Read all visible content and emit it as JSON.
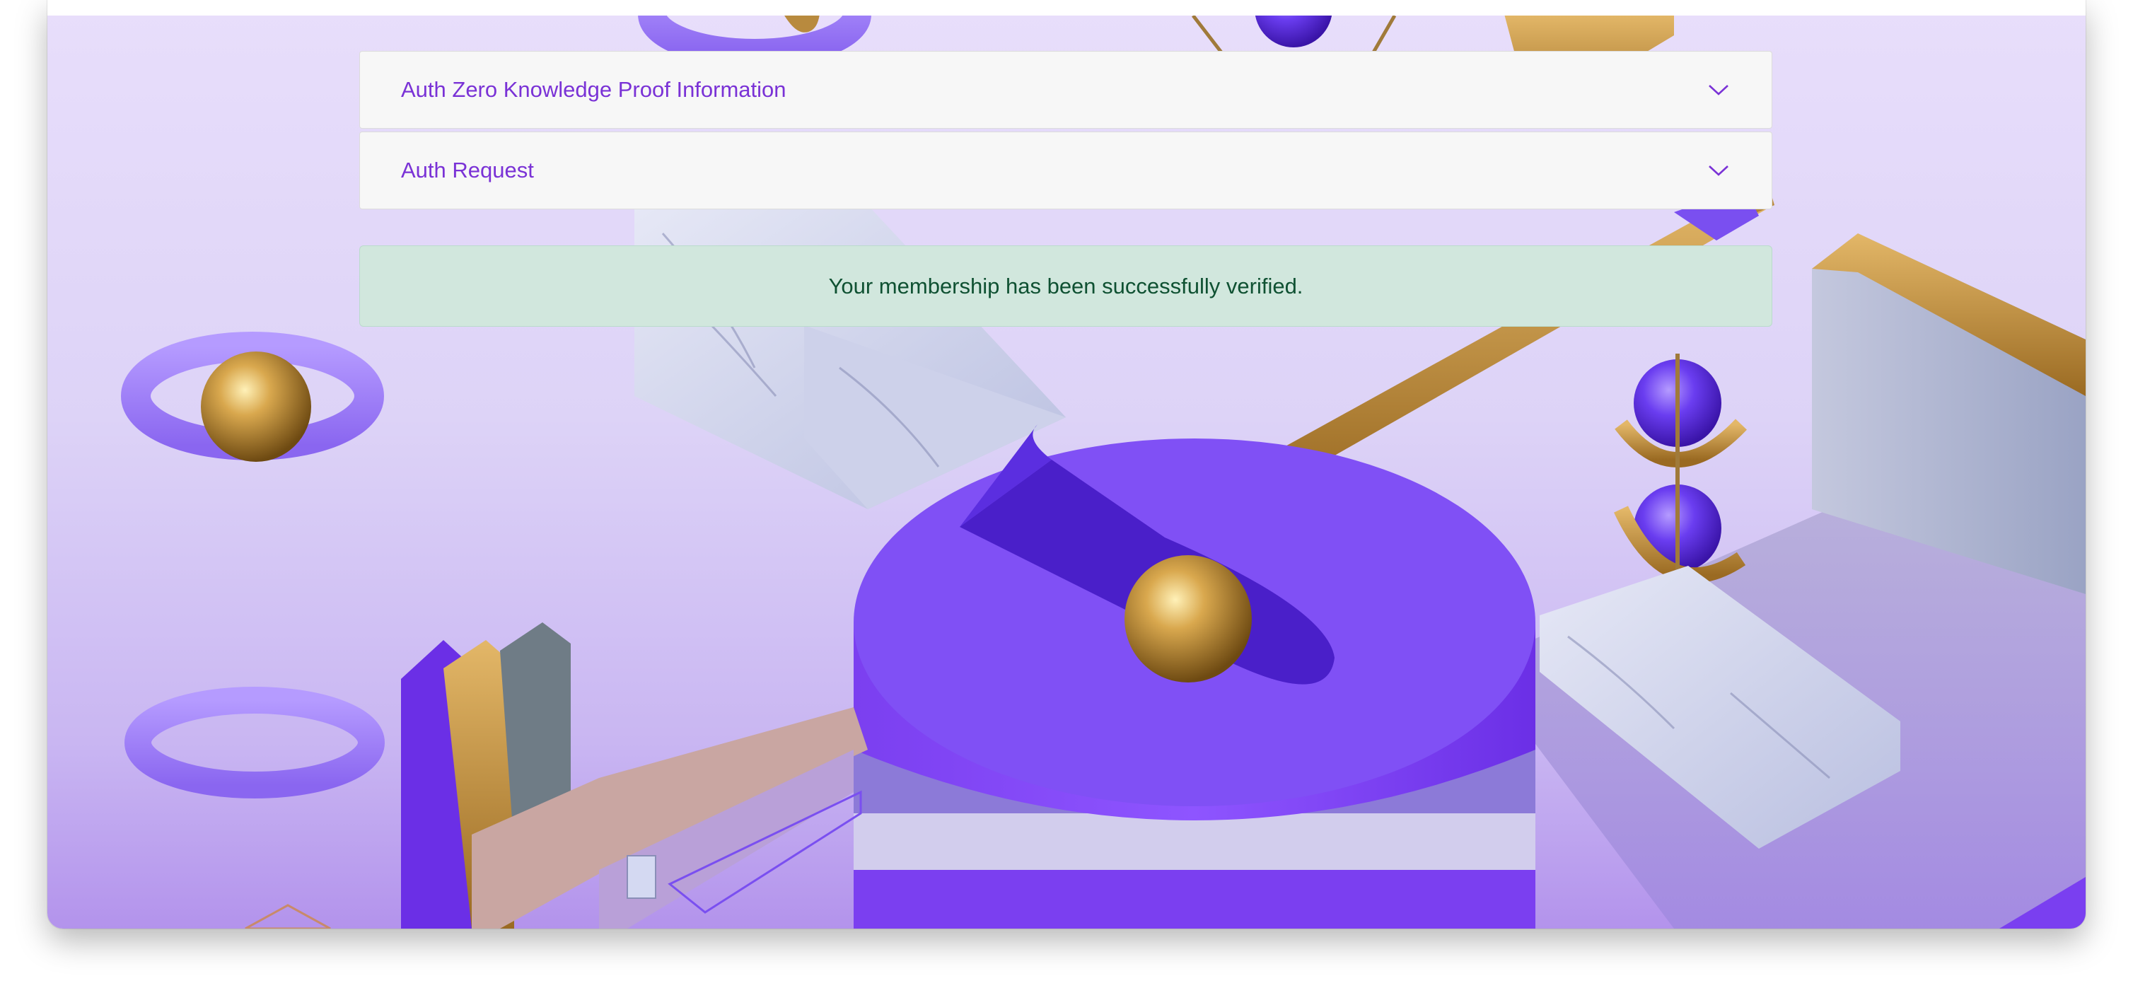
{
  "accordion": {
    "items": [
      {
        "label": "Auth Zero Knowledge Proof Information"
      },
      {
        "label": "Auth Request"
      }
    ]
  },
  "alert": {
    "message": "Your membership has been successfully verified."
  },
  "colors": {
    "accent": "#7a32d6",
    "alert_bg": "#d1e7dd",
    "alert_text": "#0f5132",
    "purple_scene": "#7a4ff0",
    "gold_scene": "#b88a3e"
  }
}
